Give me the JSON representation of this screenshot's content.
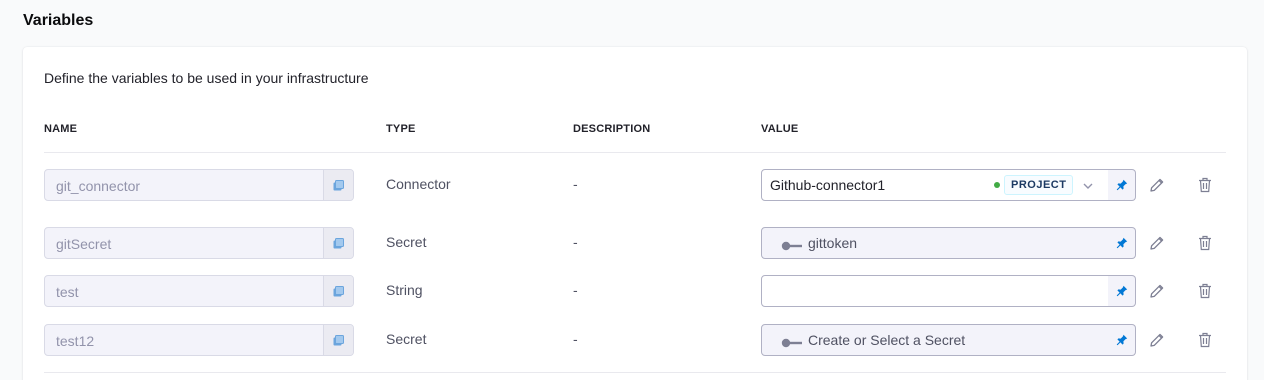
{
  "section_title": "Variables",
  "description": "Define the variables to be used in your infrastructure",
  "columns": {
    "name": "NAME",
    "type": "TYPE",
    "description": "DESCRIPTION",
    "value": "VALUE"
  },
  "rows": [
    {
      "name": "git_connector",
      "type": "Connector",
      "description": "-",
      "value": "Github-connector1",
      "scope": "PROJECT"
    },
    {
      "name": "gitSecret",
      "type": "Secret",
      "description": "-",
      "value": "gittoken"
    },
    {
      "name": "test",
      "type": "String",
      "description": "-",
      "value": ""
    },
    {
      "name": "test12",
      "type": "Secret",
      "description": "-",
      "value": "Create or Select a Secret"
    }
  ],
  "icons": {
    "copy": "copy-icon",
    "pin": "pin-icon",
    "edit": "pencil-icon",
    "delete": "trash-icon",
    "key": "key-icon",
    "chevron": "chevron-down-icon"
  },
  "colors": {
    "accent": "#0278d5",
    "status_dot": "#42ab45"
  }
}
